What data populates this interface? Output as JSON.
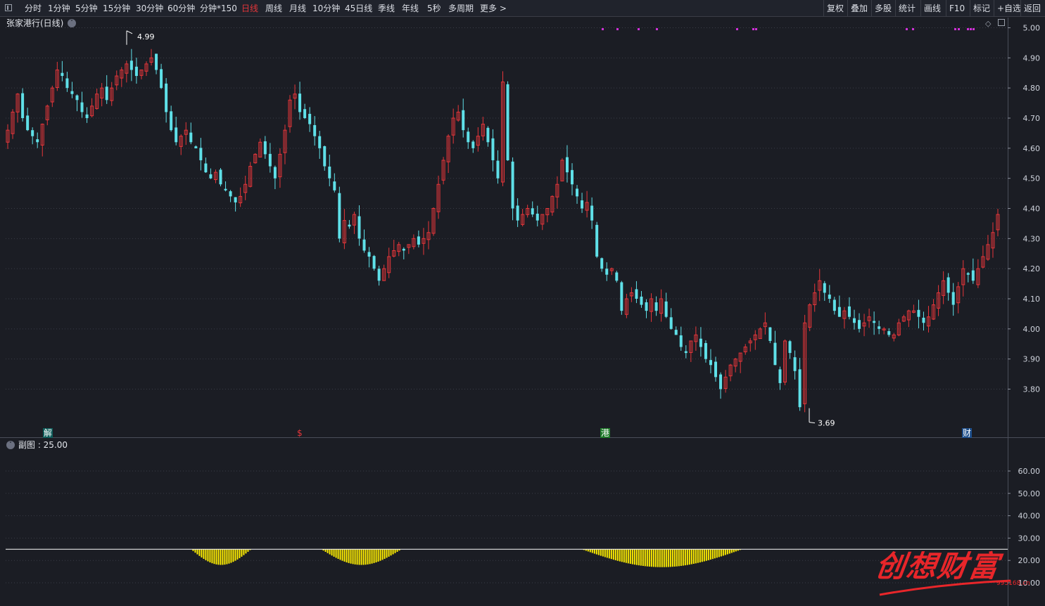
{
  "toolbar": {
    "periods": [
      "分时",
      "1分钟",
      "5分钟",
      "15分钟",
      "30分钟",
      "60分钟",
      "分钟*150",
      "日线",
      "周线",
      "月线",
      "10分钟",
      "45日线",
      "季线",
      "年线",
      "5秒",
      "多周期",
      "更多 >"
    ],
    "active": "日线",
    "right": [
      "复权",
      "叠加",
      "多股",
      "统计",
      "画线",
      "F10",
      "标记",
      "+自选",
      "返回"
    ]
  },
  "stock_title": "张家港行(日线)",
  "sub_title": "副图 : 25.00",
  "marks": {
    "jie": "解",
    "s": "$",
    "gang": "港",
    "cai": "财"
  },
  "watermark": {
    "text": "创想财富",
    "url": "995168.cn"
  },
  "colors": {
    "background": "#1b1d24",
    "up": "#e6363a",
    "down": "#5fe0e8",
    "subchart_bar": "#ffee00",
    "subchart_line": "#ffffff",
    "signal": "#d030d8"
  },
  "chart_data": [
    {
      "type": "candlestick",
      "title": "张家港行(日线)",
      "ylim": [
        3.62,
        5.02
      ],
      "yticks": [
        5.0,
        4.9,
        4.8,
        4.7,
        4.6,
        4.5,
        4.4,
        4.3,
        4.2,
        4.1,
        4.0,
        3.9,
        3.8
      ],
      "ytick_labels": [
        "5.00",
        "4.90",
        "4.80",
        "4.70",
        "4.60",
        "4.50",
        "4.40",
        "4.30",
        "4.20",
        "4.10",
        "4.00",
        "3.90",
        "3.80"
      ],
      "grid": true,
      "high_annotation": {
        "value": 4.99,
        "label": "4.99"
      },
      "low_annotation": {
        "value": 3.69,
        "label": "3.69"
      },
      "signal_dots_count": 16,
      "close": [
        4.66,
        4.72,
        4.78,
        4.7,
        4.66,
        4.64,
        4.62,
        4.68,
        4.74,
        4.8,
        4.86,
        4.84,
        4.8,
        4.78,
        4.76,
        4.72,
        4.7,
        4.74,
        4.78,
        4.8,
        4.76,
        4.8,
        4.84,
        4.86,
        4.88,
        4.86,
        4.84,
        4.86,
        4.88,
        4.9,
        4.86,
        4.8,
        4.72,
        4.66,
        4.62,
        4.64,
        4.66,
        4.62,
        4.6,
        4.56,
        4.52,
        4.5,
        4.52,
        4.48,
        4.46,
        4.44,
        4.42,
        4.44,
        4.48,
        4.54,
        4.58,
        4.62,
        4.58,
        4.54,
        4.5,
        4.58,
        4.66,
        4.76,
        4.78,
        4.72,
        4.7,
        4.68,
        4.64,
        4.6,
        4.54,
        4.5,
        4.46,
        4.3,
        4.36,
        4.34,
        4.38,
        4.3,
        4.26,
        4.24,
        4.2,
        4.16,
        4.2,
        4.24,
        4.26,
        4.28,
        4.26,
        4.28,
        4.3,
        4.28,
        4.3,
        4.32,
        4.4,
        4.48,
        4.56,
        4.64,
        4.7,
        4.72,
        4.66,
        4.62,
        4.6,
        4.64,
        4.68,
        4.62,
        4.56,
        4.5,
        4.82,
        4.56,
        4.4,
        4.36,
        4.38,
        4.4,
        4.38,
        4.36,
        4.38,
        4.4,
        4.44,
        4.48,
        4.56,
        4.52,
        4.48,
        4.44,
        4.4,
        4.42,
        4.36,
        4.24,
        4.2,
        4.18,
        4.2,
        4.16,
        4.06,
        4.1,
        4.12,
        4.1,
        4.08,
        4.06,
        4.1,
        4.06,
        4.1,
        4.04,
        4.0,
        3.98,
        3.94,
        3.92,
        3.96,
        3.98,
        3.94,
        3.9,
        3.88,
        3.84,
        3.8,
        3.84,
        3.88,
        3.9,
        3.92,
        3.94,
        3.96,
        3.98,
        4.0,
        4.02,
        3.96,
        3.88,
        3.82,
        3.96,
        3.92,
        3.86,
        3.74,
        4.02,
        4.08,
        4.12,
        4.16,
        4.12,
        4.1,
        4.06,
        4.04,
        4.06,
        4.04,
        4.02,
        4.0,
        4.02,
        4.04,
        4.02,
        4.0,
        4.0,
        3.98,
        3.98,
        4.02,
        4.04,
        4.06,
        4.06,
        4.04,
        4.02,
        4.04,
        4.08,
        4.12,
        4.16,
        4.12,
        4.08,
        4.14,
        4.2,
        4.18,
        4.16,
        4.2,
        4.24,
        4.28,
        4.32,
        4.38
      ],
      "xlim": [
        0,
        197
      ]
    },
    {
      "type": "bar",
      "title": "副图 : 25.00",
      "ylim": [
        5,
        70
      ],
      "yticks": [
        60.0,
        50.0,
        40.0,
        30.0,
        20.0,
        10.0
      ],
      "ytick_labels": [
        "60.00",
        "50.00",
        "40.00",
        "30.00",
        "20.00",
        "10.00"
      ],
      "baseline": 25.0,
      "grid": true,
      "segments": [
        {
          "start": 0.185,
          "end": 0.245,
          "min": 18
        },
        {
          "start": 0.315,
          "end": 0.395,
          "min": 18
        },
        {
          "start": 0.575,
          "end": 0.735,
          "min": 17
        }
      ]
    }
  ]
}
